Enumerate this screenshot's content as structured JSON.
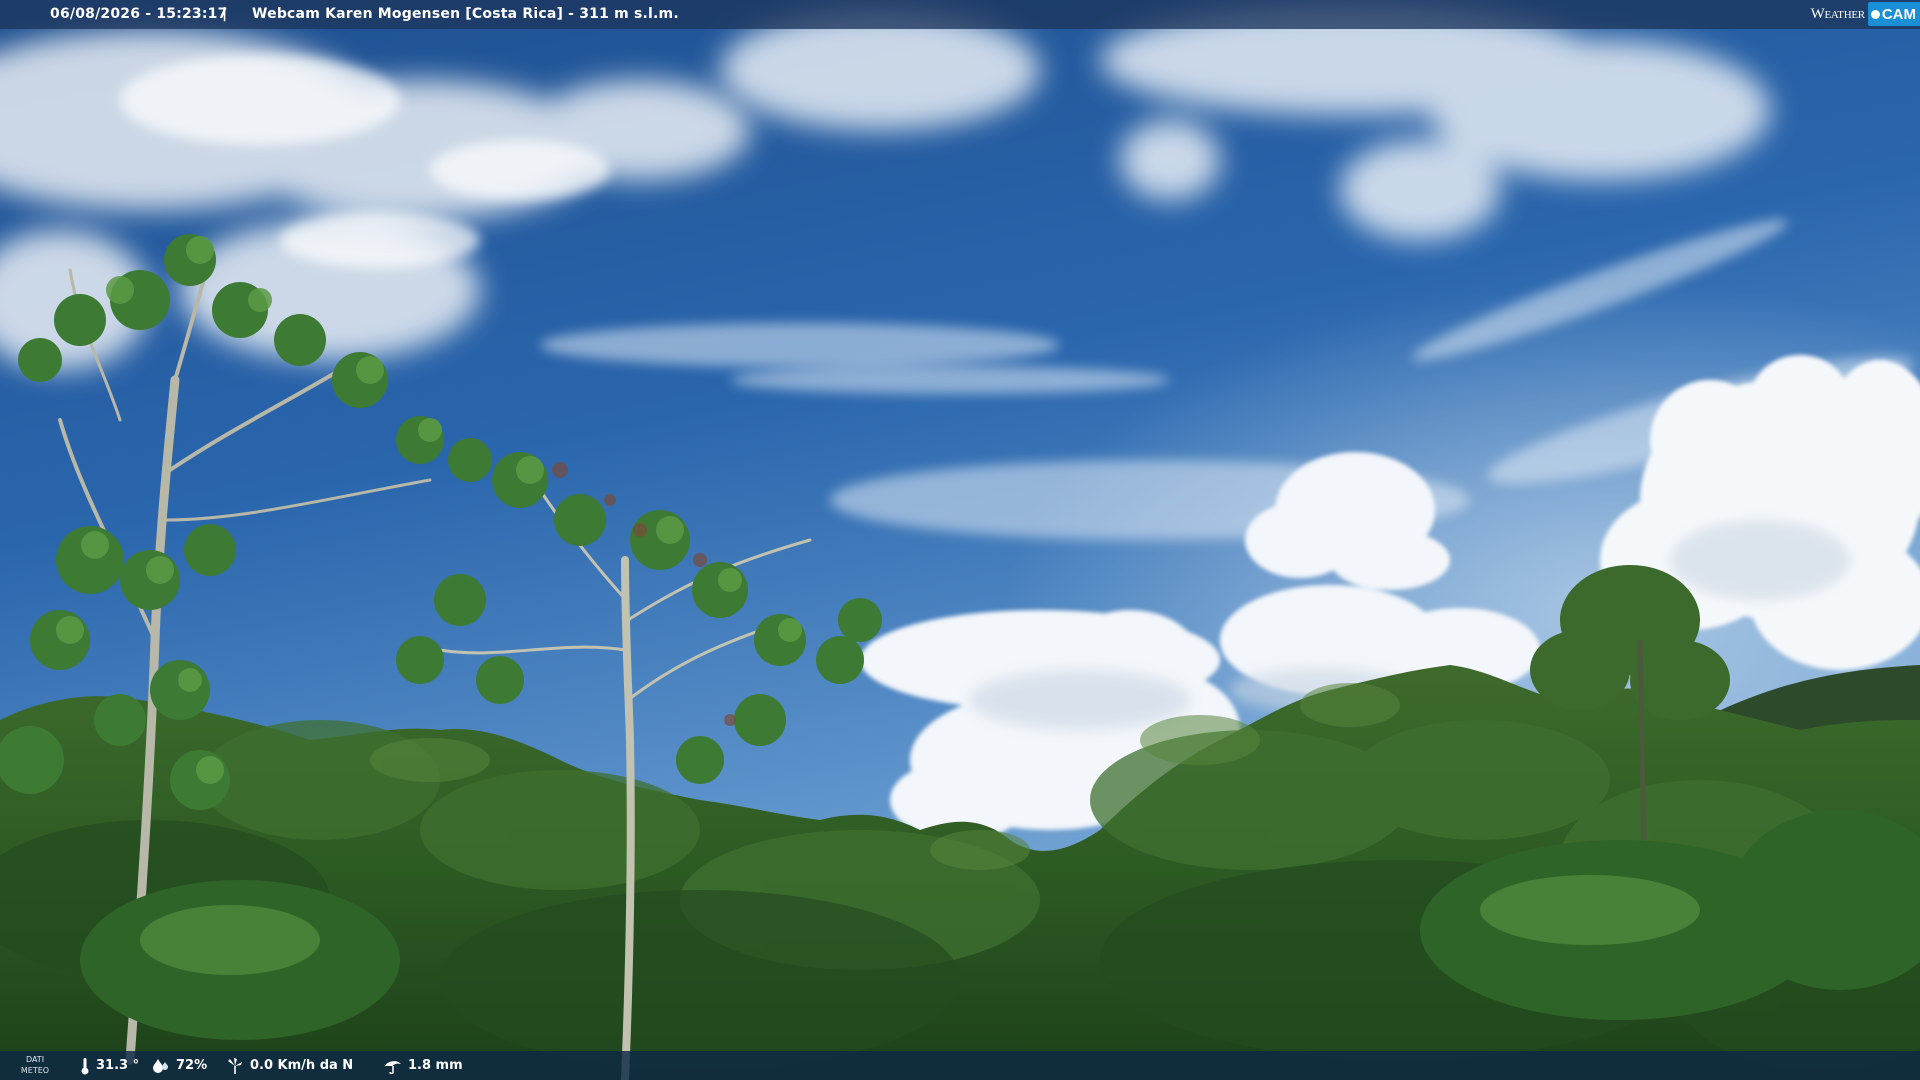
{
  "header": {
    "datetime": "06/08/2026 - 15:23:17",
    "separator": "|",
    "title": "Webcam Karen Mogensen [Costa Rica]  - 311 m s.l.m."
  },
  "brand": {
    "weather": "Weather",
    "cam": "CAM",
    "accent_color": "#1a8fd6"
  },
  "weather_bar": {
    "label_line1": "DATI",
    "label_line2": "METEO",
    "temperature": "31.3 °",
    "humidity": "72%",
    "wind": "0.0 Km/h da N",
    "rain": "1.8 mm",
    "icons": {
      "temperature": "thermometer-icon",
      "humidity": "humidity-icon",
      "wind": "wind-icon",
      "rain": "rain-icon"
    }
  }
}
